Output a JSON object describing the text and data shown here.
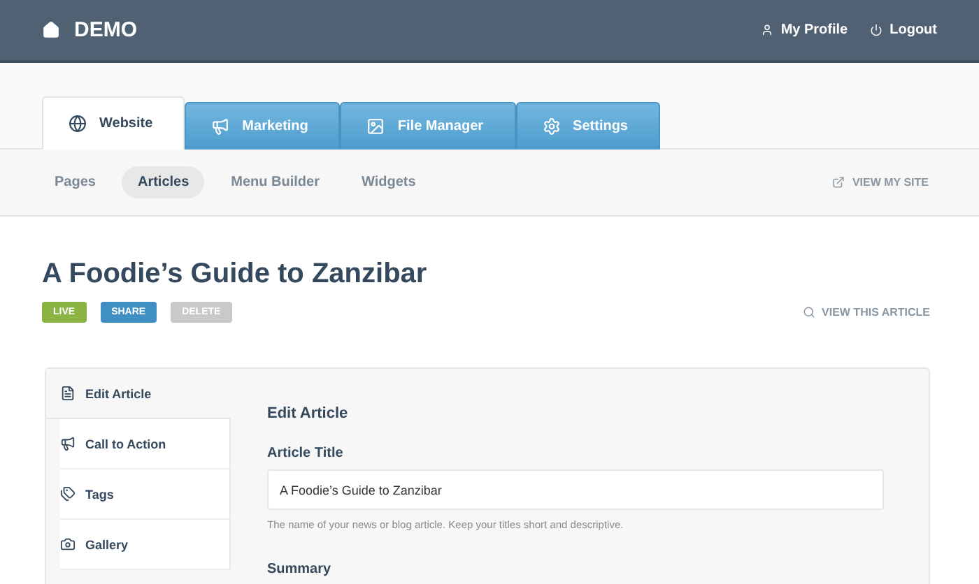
{
  "header": {
    "brand": "DEMO",
    "links": [
      {
        "kind": "profile",
        "label": "My Profile"
      },
      {
        "kind": "logout",
        "label": "Logout"
      }
    ]
  },
  "tabs": [
    {
      "kind": "website",
      "label": "Website",
      "selected": true
    },
    {
      "kind": "marketing",
      "label": "Marketing",
      "selected": false
    },
    {
      "kind": "files",
      "label": "File Manager",
      "selected": false
    },
    {
      "kind": "settings",
      "label": "Settings",
      "selected": false
    }
  ],
  "subnav": {
    "items": [
      {
        "label": "Pages",
        "selected": false
      },
      {
        "label": "Articles",
        "selected": true
      },
      {
        "label": "Menu Builder",
        "selected": false
      },
      {
        "label": "Widgets",
        "selected": false
      }
    ],
    "view_site": "VIEW MY SITE"
  },
  "article": {
    "title": "A Foodie’s Guide to Zanzibar",
    "actions": [
      {
        "kind": "live",
        "label": "LIVE",
        "disabled": false
      },
      {
        "kind": "share",
        "label": "SHARE",
        "disabled": false
      },
      {
        "kind": "delete",
        "label": "DELETE",
        "disabled": true
      }
    ],
    "view_article": "VIEW THIS ARTICLE"
  },
  "sidebar": {
    "items": [
      {
        "kind": "file",
        "label": "Edit Article",
        "selected": true
      },
      {
        "kind": "megaphone",
        "label": "Call to Action",
        "selected": false
      },
      {
        "kind": "tags",
        "label": "Tags",
        "selected": false
      },
      {
        "kind": "camera",
        "label": "Gallery",
        "selected": false
      }
    ]
  },
  "form": {
    "heading": "Edit Article",
    "fields": [
      {
        "label": "Article Title",
        "value": "A Foodie’s Guide to Zanzibar",
        "help": "The name of your news or blog article. Keep your titles short and descriptive."
      },
      {
        "label": "Summary"
      }
    ]
  }
}
